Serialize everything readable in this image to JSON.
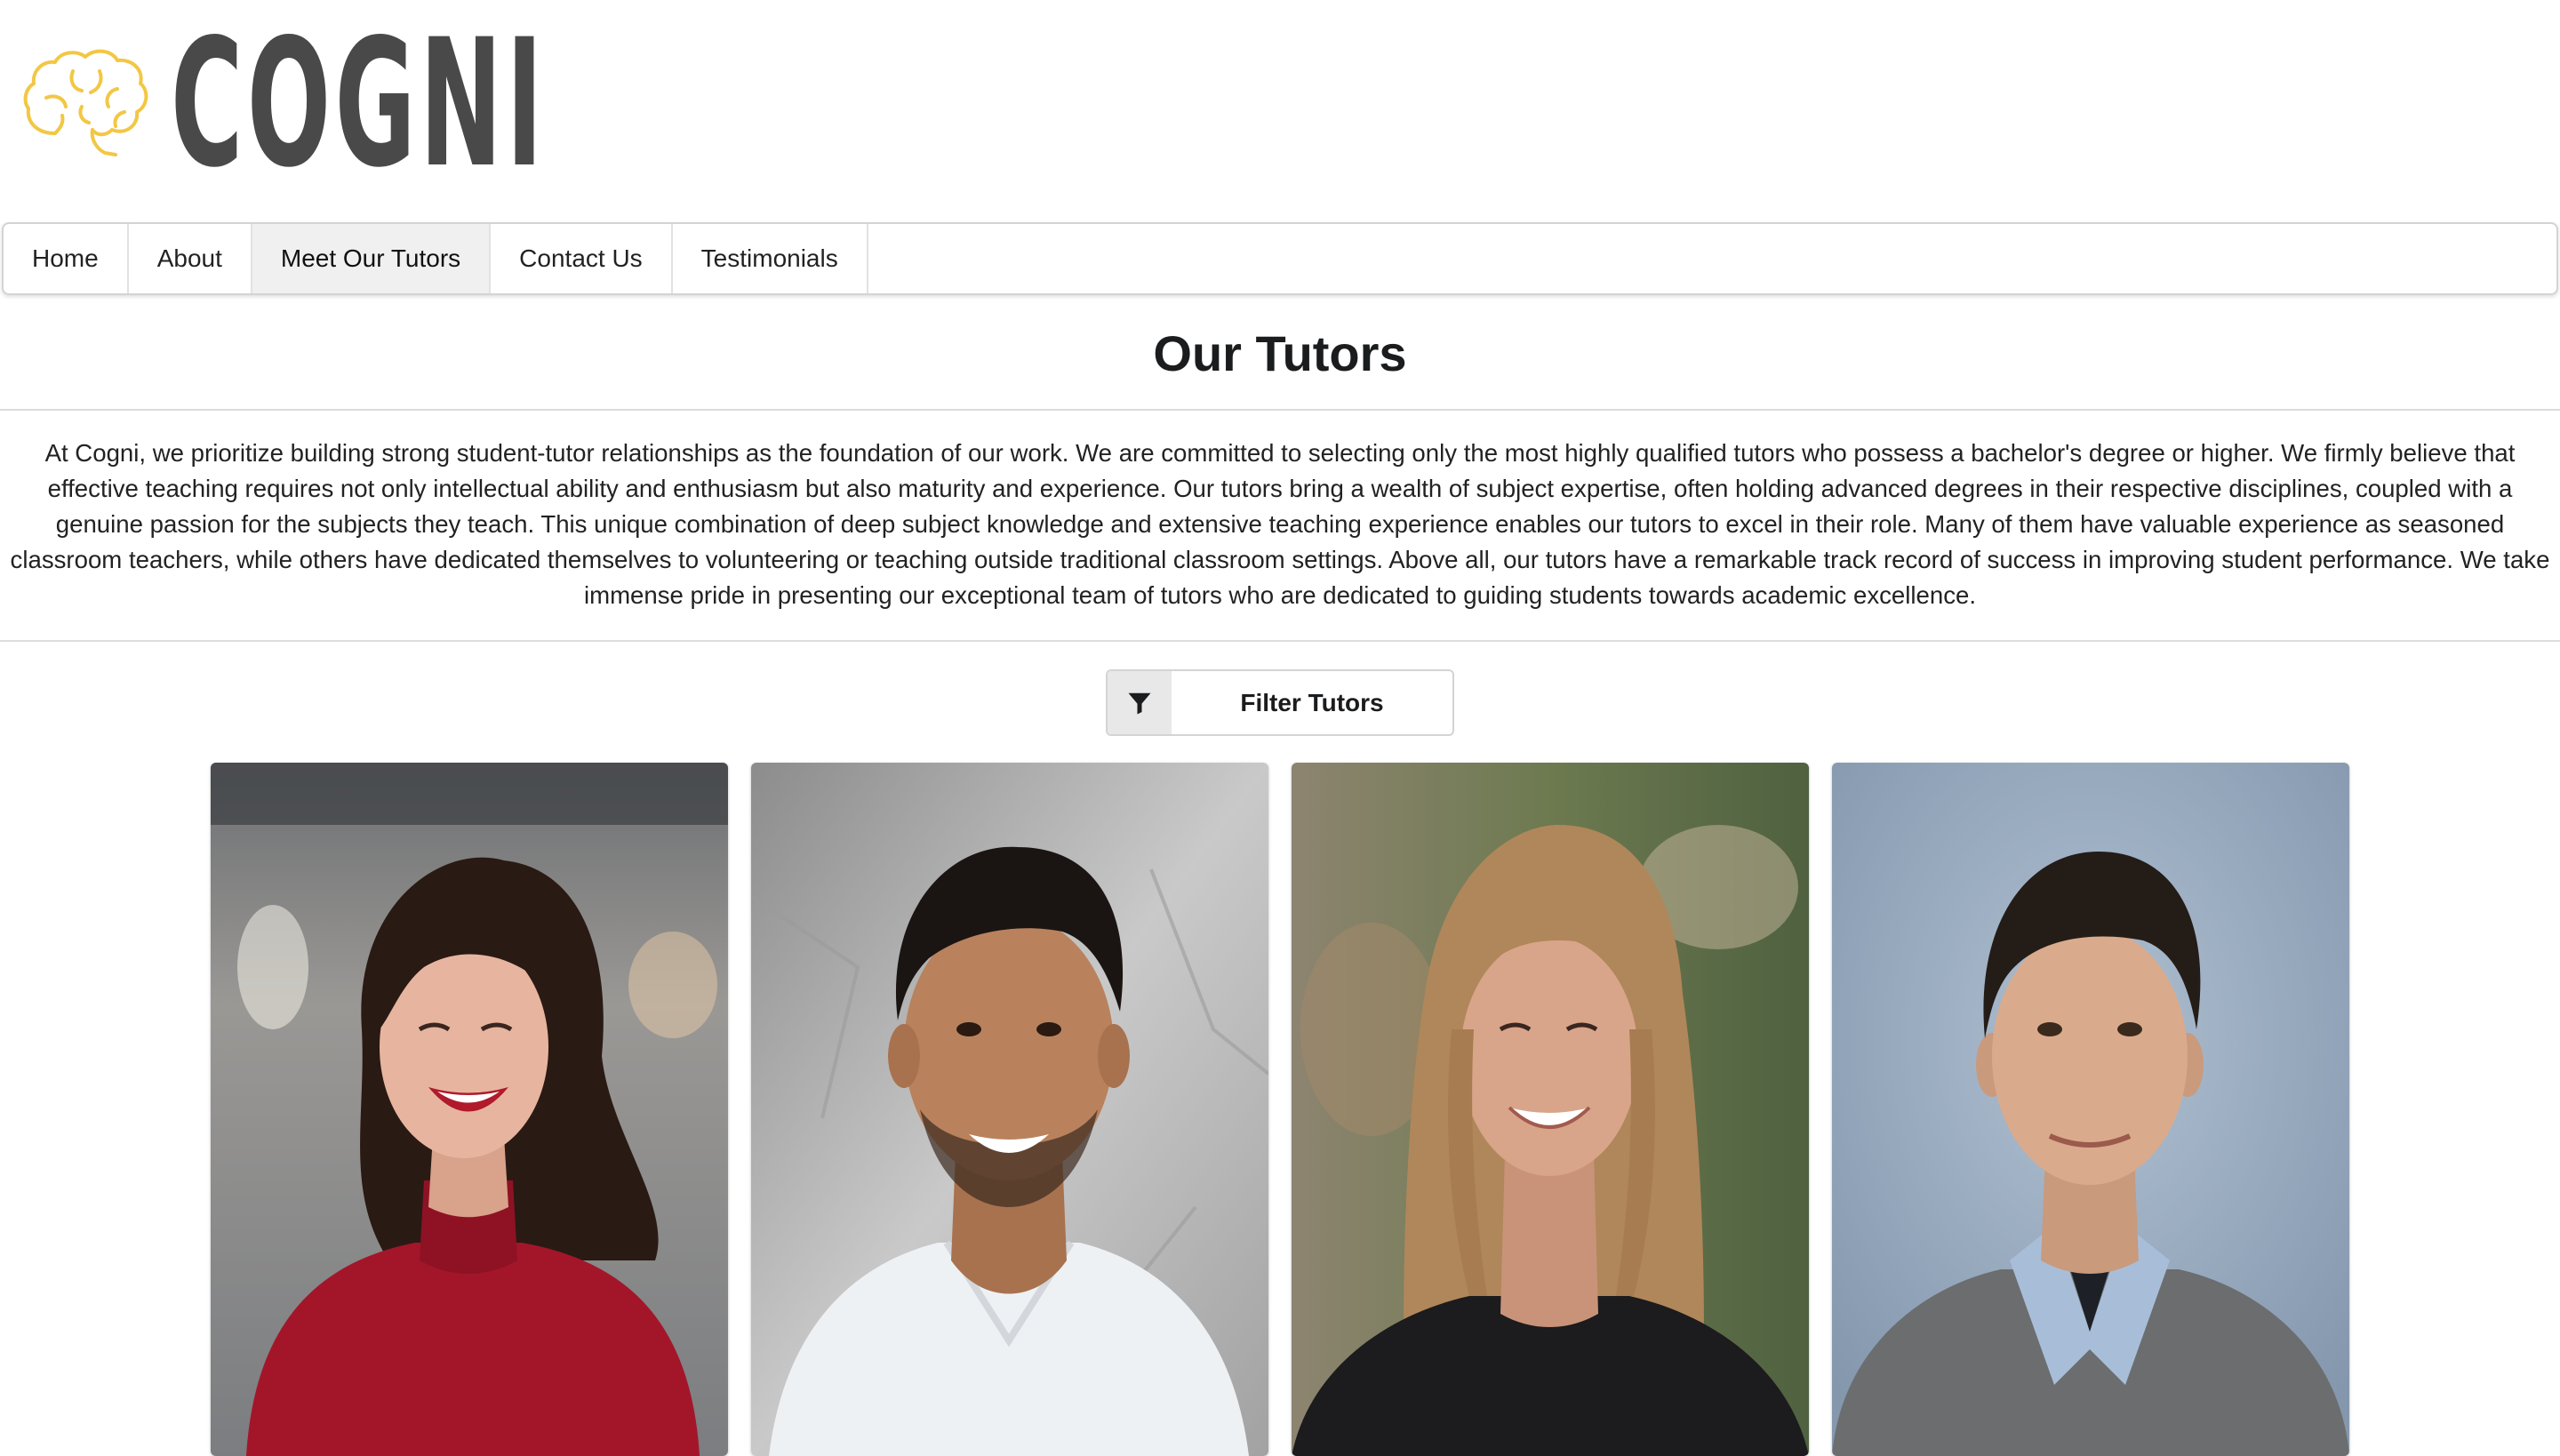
{
  "brand": {
    "name": "COGNI",
    "accent_color": "#f2c744",
    "text_color": "#494949",
    "logo_icon": "brain-icon"
  },
  "nav": {
    "items": [
      {
        "label": "Home",
        "active": false
      },
      {
        "label": "About",
        "active": false
      },
      {
        "label": "Meet Our Tutors",
        "active": true
      },
      {
        "label": "Contact Us",
        "active": false
      },
      {
        "label": "Testimonials",
        "active": false
      }
    ]
  },
  "page": {
    "title": "Our Tutors",
    "intro": "At Cogni, we prioritize building strong student-tutor relationships as the foundation of our work. We are committed to selecting only the most highly qualified tutors who possess a bachelor's degree or higher. We firmly believe that effective teaching requires not only intellectual ability and enthusiasm but also maturity and experience. Our tutors bring a wealth of subject expertise, often holding advanced degrees in their respective disciplines, coupled with a genuine passion for the subjects they teach. This unique combination of deep subject knowledge and extensive teaching experience enables our tutors to excel in their role. Many of them have valuable experience as seasoned classroom teachers, while others have dedicated themselves to volunteering or teaching outside traditional classroom settings. Above all, our tutors have a remarkable track record of success in improving student performance. We take immense pride in presenting our exceptional team of tutors who are dedicated to guiding students towards academic excellence."
  },
  "filter": {
    "label": "Filter Tutors",
    "icon": "filter-icon"
  },
  "tutors": [
    {
      "photo": "tutor-photo-woman-red-sweater",
      "bg": "#8a8c8f",
      "shirt": "#a3162a",
      "hair": "#2a1a14",
      "skin": "#e7b59f"
    },
    {
      "photo": "tutor-photo-man-white-tshirt",
      "bg": "#bcbcbc",
      "shirt": "#eef1f4",
      "hair": "#1a1512",
      "skin": "#b9825d"
    },
    {
      "photo": "tutor-photo-woman-long-hair",
      "bg": "#6f7a55",
      "shirt": "#1c1b1d",
      "hair": "#b0875a",
      "skin": "#d9a58a"
    },
    {
      "photo": "tutor-photo-man-grey-sweater",
      "bg": "#9aabbf",
      "shirt": "#6b6d6f",
      "hair": "#241c17",
      "skin": "#d9ab8c"
    }
  ]
}
